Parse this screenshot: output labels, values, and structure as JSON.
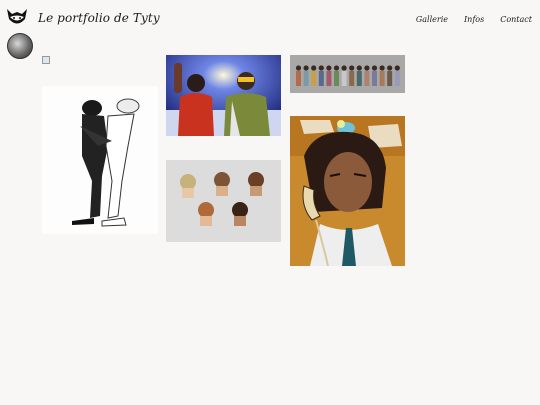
{
  "header": {
    "site_title": "Le portfolio de Tyty",
    "nav": [
      "Gallerie",
      "Infos",
      "Contact"
    ],
    "logo_icon": "fox-head-icon",
    "avatar_icon": "avatar-icon"
  },
  "gallery": {
    "broken_image_icon": "broken-image-icon",
    "items": [
      {
        "name": "artwork-inked-figures"
      },
      {
        "name": "artwork-two-characters-night"
      },
      {
        "name": "artwork-character-lineup"
      },
      {
        "name": "artwork-head-studies"
      },
      {
        "name": "artwork-phone-portrait"
      }
    ]
  }
}
